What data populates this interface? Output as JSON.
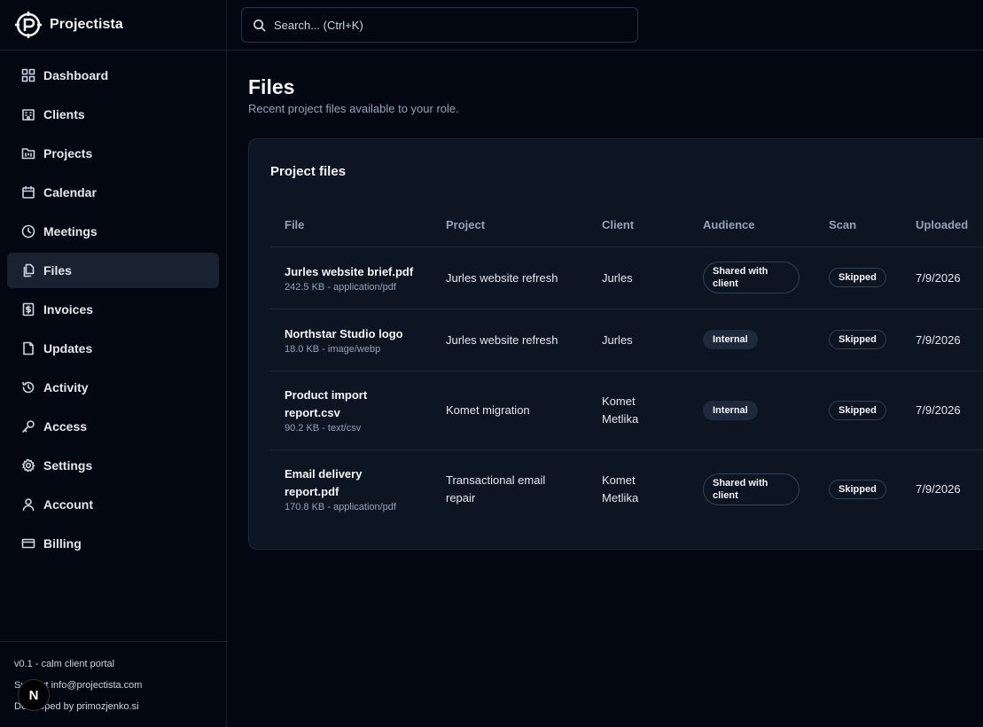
{
  "app": {
    "name": "Projectista"
  },
  "search": {
    "placeholder": "Search... (Ctrl+K)"
  },
  "sidebar": {
    "items": [
      {
        "label": "Dashboard",
        "icon": "grid-icon"
      },
      {
        "label": "Clients",
        "icon": "building-icon"
      },
      {
        "label": "Projects",
        "icon": "folder-kanban-icon"
      },
      {
        "label": "Calendar",
        "icon": "calendar-icon"
      },
      {
        "label": "Meetings",
        "icon": "clock-icon"
      },
      {
        "label": "Files",
        "icon": "files-icon",
        "active": true
      },
      {
        "label": "Invoices",
        "icon": "dollar-receipt-icon"
      },
      {
        "label": "Updates",
        "icon": "file-icon"
      },
      {
        "label": "Activity",
        "icon": "history-icon"
      },
      {
        "label": "Access",
        "icon": "key-icon"
      },
      {
        "label": "Settings",
        "icon": "gear-icon"
      },
      {
        "label": "Account",
        "icon": "user-icon"
      },
      {
        "label": "Billing",
        "icon": "credit-card-icon"
      }
    ],
    "footer": {
      "version": "v0.1 - calm client portal",
      "support": "Support info@projectista.com",
      "developer": "Developed by primozjenko.si",
      "badge": "N"
    }
  },
  "page": {
    "title": "Files",
    "subtitle": "Recent project files available to your role."
  },
  "card": {
    "title": "Project files",
    "columns": [
      "File",
      "Project",
      "Client",
      "Audience",
      "Scan",
      "Uploaded"
    ],
    "rows": [
      {
        "file": "Jurles website brief.pdf",
        "meta": "242.5 KB - application/pdf",
        "project": "Jurles website refresh",
        "client": "Jurles",
        "audience": "Shared with client",
        "scan": "Skipped",
        "uploaded": "7/9/2026"
      },
      {
        "file": "Northstar Studio logo",
        "meta": "18.0 KB - image/webp",
        "project": "Jurles website refresh",
        "client": "Jurles",
        "audience": "Internal",
        "scan": "Skipped",
        "uploaded": "7/9/2026"
      },
      {
        "file": "Product import report.csv",
        "meta": "90.2 KB - text/csv",
        "project": "Komet migration",
        "client": "Komet Metlika",
        "audience": "Internal",
        "scan": "Skipped",
        "uploaded": "7/9/2026"
      },
      {
        "file": "Email delivery report.pdf",
        "meta": "170.8 KB - application/pdf",
        "project": "Transactional email repair",
        "client": "Komet Metlika",
        "audience": "Shared with client",
        "scan": "Skipped",
        "uploaded": "7/9/2026"
      }
    ]
  }
}
